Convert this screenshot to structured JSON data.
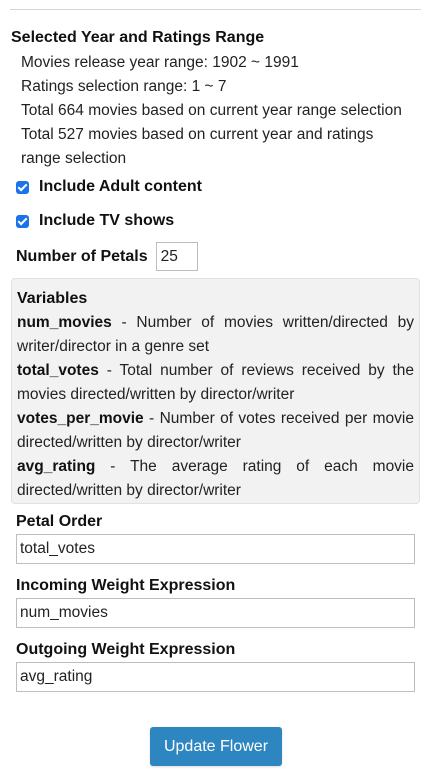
{
  "selection": {
    "title": "Selected Year and Ratings Range",
    "lines": [
      "Movies release year range: 1902 ~ 1991",
      "Ratings selection range: 1 ~ 7",
      "Total 664 movies based on current year range selection",
      "Total 527 movies based on current year and ratings",
      "range selection"
    ]
  },
  "options": {
    "include_adult_label": "Include Adult content",
    "include_adult_checked": true,
    "include_tv_label": "Include TV shows",
    "include_tv_checked": true
  },
  "petals": {
    "label": "Number of Petals",
    "value": "25"
  },
  "variables": {
    "title": "Variables",
    "items": [
      {
        "name": "num_movies",
        "description": " - Number of movies written/directed by writer/director in a genre set"
      },
      {
        "name": "total_votes",
        "description": " - Total number of reviews received by the movies directed/written by director/writer"
      },
      {
        "name": "votes_per_movie",
        "description": " - Number of votes received per movie directed/written by director/writer"
      },
      {
        "name": "avg_rating",
        "description": " - The average rating of each movie directed/written by director/writer"
      }
    ]
  },
  "fields": {
    "petal_order_label": "Petal Order",
    "petal_order_value": "total_votes",
    "incoming_label": "Incoming Weight Expression",
    "incoming_value": "num_movies",
    "outgoing_label": "Outgoing Weight Expression",
    "outgoing_value": "avg_rating"
  },
  "actions": {
    "update_label": "Update Flower"
  },
  "colors": {
    "button": "#2e86c1",
    "checkbox": "#1a73e8",
    "variables_bg": "#f2f2f2"
  }
}
